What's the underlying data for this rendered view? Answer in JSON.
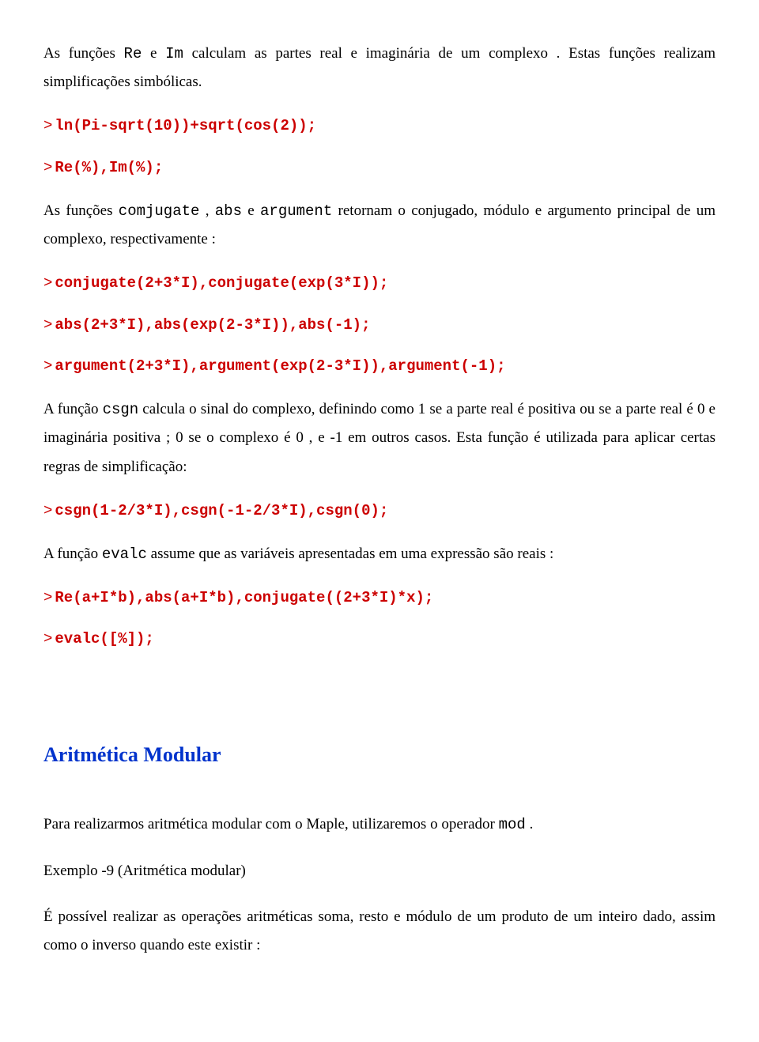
{
  "p1_a": "As funções ",
  "p1_fn1": "Re",
  "p1_b": " e ",
  "p1_fn2": "Im",
  "p1_c": " calculam as partes real e imaginária de um complexo . Estas funções realizam simplificações simbólicas.",
  "code1": "ln(Pi-sqrt(10))+sqrt(cos(2));",
  "code2": "Re(%),Im(%);",
  "p2_a": "As funções ",
  "p2_fn1": "comjugate",
  "p2_b": " , ",
  "p2_fn2": "abs",
  "p2_c": " e  ",
  "p2_fn3": "argument",
  "p2_d": "  retornam o conjugado, módulo e argumento principal de um complexo, respectivamente :",
  "code3": "conjugate(2+3*I),conjugate(exp(3*I));",
  "code4": "abs(2+3*I),abs(exp(2-3*I)),abs(-1);",
  "code5": "argument(2+3*I),argument(exp(2-3*I)),argument(-1);",
  "p3_a": "A função ",
  "p3_fn1": "csgn",
  "p3_b": " calcula o sinal do complexo, definindo como 1 se a parte real  é positiva ou se a parte real é 0 e imaginária positiva ; 0 se o complexo é 0 , e  -1  em outros casos. Esta função é utilizada para aplicar certas regras de simplificação:",
  "code6": "csgn(1-2/3*I),csgn(-1-2/3*I),csgn(0);",
  "p4_a": "A função ",
  "p4_fn1": "evalc",
  "p4_b": " assume que as variáveis apresentadas em uma expressão são reais :",
  "code7": "Re(a+I*b),abs(a+I*b),conjugate((2+3*I)*x);",
  "code8": "evalc([%]);",
  "heading": "Aritmética Modular",
  "p5_a": "Para realizarmos aritmética modular com o Maple, utilizaremos o operador ",
  "p5_fn1": "mod",
  "p5_b": " .",
  "p6": "Exemplo -9 (Aritmética modular)",
  "p7": "É possível realizar as operações aritméticas soma, resto e módulo de um produto de um inteiro dado, assim como o inverso quando este existir :",
  "prompt": ">"
}
